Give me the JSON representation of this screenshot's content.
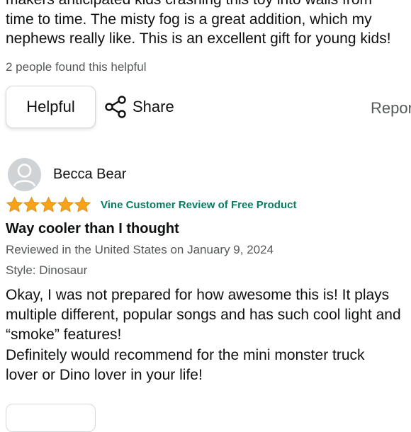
{
  "previous_review": {
    "lines": [
      "makers anticipated kids crashing this toy into walls from",
      "time to time. The misty fog is a great addition, which my",
      "nephews really like. This is an excellent gift for young kids!"
    ],
    "helpful_count": "2 people found this helpful",
    "helpful_button": "Helpful",
    "share_label": "Share",
    "report_label": "Report"
  },
  "review": {
    "reviewer_name": "Becca Bear",
    "rating": 5,
    "rating_max": 5,
    "vine_badge": "Vine Customer Review of Free Product",
    "title": "Way cooler than I thought",
    "reviewed_in": "Reviewed in the United States on January 9, 2024",
    "style": "Style: Dinosaur",
    "body_lines": [
      "Okay, I was not prepared for how awesome this is! It plays",
      "multiple different, popular songs and has such cool light and",
      "“smoke” features!",
      "Definitely would recommend for the mini monster truck",
      "lover or Dino lover in your life!"
    ]
  },
  "colors": {
    "star": "#f7a21b",
    "vine_green": "#067d62",
    "secondary_text": "#565959"
  },
  "icons": {
    "share": "share-icon",
    "avatar": "user-avatar-icon",
    "star": "star-icon"
  }
}
